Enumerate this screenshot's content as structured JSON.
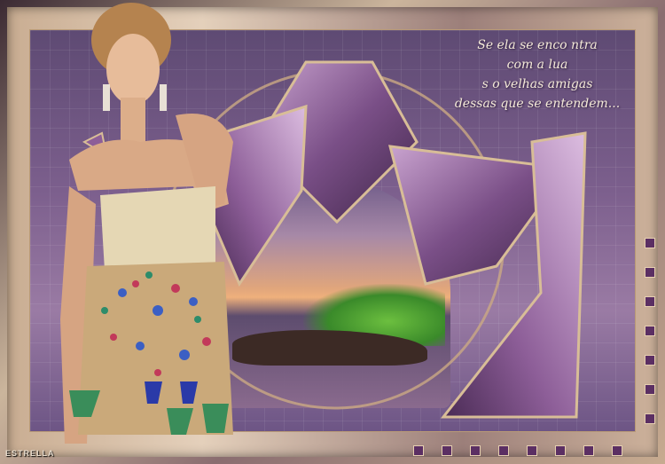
{
  "poem": {
    "lines": [
      "Se ela se enco ntra",
      "com a lua",
      "s   o velhas amigas",
      "dessas que se entendem..."
    ]
  },
  "signature": "ESTRELLA",
  "colors": {
    "panel": "#7c5f8d",
    "frame": "#c9ad92",
    "accent_squares": "#5b2f63"
  },
  "decorations": {
    "right_squares": 7,
    "bottom_squares": 8
  }
}
